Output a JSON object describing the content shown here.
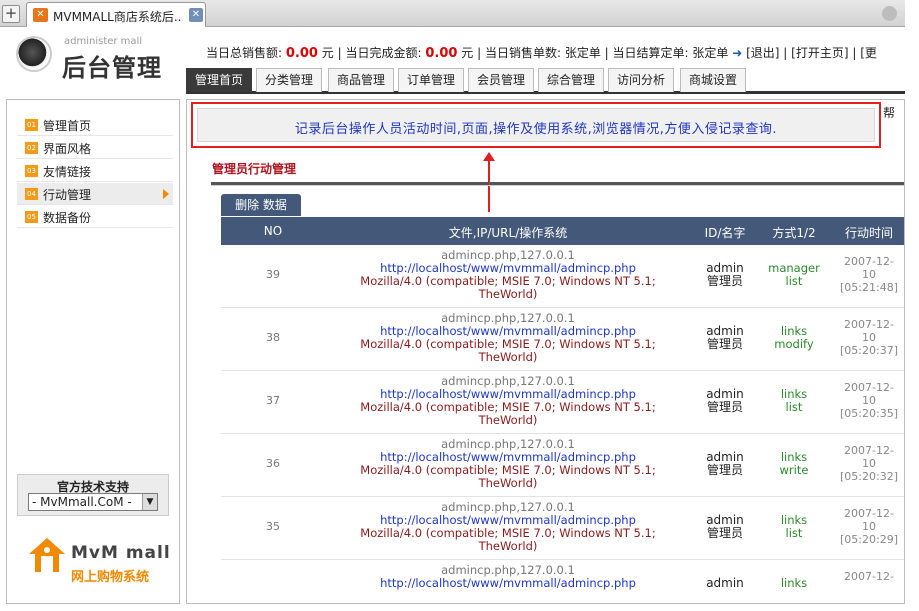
{
  "browser": {
    "new_tab": "+",
    "tab_title": "MVMMALL商店系统后...",
    "tab_icon": "✕",
    "tab_close": "✕"
  },
  "header": {
    "logo_sub": "administer mall",
    "logo_title": "后台管理",
    "info": {
      "sales_label": "当日总销售额:",
      "sales_value": "0.00",
      "unit1": "元",
      "done_label": "| 当日完成金额:",
      "done_value": "0.00",
      "unit2": "元",
      "orders_label": "| 当日销售单数: 张定单",
      "settle_label": "| 当日结算定单: 张定单",
      "arrow": "➜",
      "logout": "[退出]",
      "open_home": "| [打开主页]",
      "more": "| [更"
    },
    "nav": [
      "管理首页",
      "分类管理",
      "商品管理",
      "订单管理",
      "会员管理",
      "综合管理",
      "访问分析",
      "商城设置"
    ]
  },
  "sidebar": {
    "items": [
      {
        "num": "01",
        "label": "管理首页"
      },
      {
        "num": "02",
        "label": "界面风格"
      },
      {
        "num": "03",
        "label": "友情链接"
      },
      {
        "num": "04",
        "label": "行动管理"
      },
      {
        "num": "05",
        "label": "数据备份"
      }
    ],
    "support_title": "官方技术支持",
    "support_select": "- MvMmall.CoM -",
    "support_caret": "▼",
    "brand_name": "MvM mall",
    "brand_tag": "网上购物系统"
  },
  "content": {
    "notice": "记录后台操作人员活动时间,页面,操作及使用系统,浏览器情况,方便入侵记录查询.",
    "notice_extra": "帮",
    "section_title": "管理员行动管理",
    "action_button": "删除 数据",
    "table": {
      "headers": [
        "NO",
        "文件,IP/URL/操作系统",
        "ID/名字",
        "方式1/2",
        "行动时间"
      ],
      "rows": [
        {
          "no": "39",
          "file": "admincp.php,127.0.0.1",
          "url": "http://localhost/www/mvmmall/admincp.php",
          "ua1": "Mozilla/4.0 (compatible; MSIE 7.0; Windows NT 5.1;",
          "ua2": "TheWorld)",
          "id": "admin",
          "name": "管理员",
          "m1": "manager",
          "m2": "list",
          "t1": "2007-12-",
          "t2": "10",
          "t3": "[05:21:48]"
        },
        {
          "no": "38",
          "file": "admincp.php,127.0.0.1",
          "url": "http://localhost/www/mvmmall/admincp.php",
          "ua1": "Mozilla/4.0 (compatible; MSIE 7.0; Windows NT 5.1;",
          "ua2": "TheWorld)",
          "id": "admin",
          "name": "管理员",
          "m1": "links",
          "m2": "modify",
          "t1": "2007-12-",
          "t2": "10",
          "t3": "[05:20:37]"
        },
        {
          "no": "37",
          "file": "admincp.php,127.0.0.1",
          "url": "http://localhost/www/mvmmall/admincp.php",
          "ua1": "Mozilla/4.0 (compatible; MSIE 7.0; Windows NT 5.1;",
          "ua2": "TheWorld)",
          "id": "admin",
          "name": "管理员",
          "m1": "links",
          "m2": "list",
          "t1": "2007-12-",
          "t2": "10",
          "t3": "[05:20:35]"
        },
        {
          "no": "36",
          "file": "admincp.php,127.0.0.1",
          "url": "http://localhost/www/mvmmall/admincp.php",
          "ua1": "Mozilla/4.0 (compatible; MSIE 7.0; Windows NT 5.1;",
          "ua2": "TheWorld)",
          "id": "admin",
          "name": "管理员",
          "m1": "links",
          "m2": "write",
          "t1": "2007-12-",
          "t2": "10",
          "t3": "[05:20:32]"
        },
        {
          "no": "35",
          "file": "admincp.php,127.0.0.1",
          "url": "http://localhost/www/mvmmall/admincp.php",
          "ua1": "Mozilla/4.0 (compatible; MSIE 7.0; Windows NT 5.1;",
          "ua2": "TheWorld)",
          "id": "admin",
          "name": "管理员",
          "m1": "links",
          "m2": "list",
          "t1": "2007-12-",
          "t2": "10",
          "t3": "[05:20:29]"
        },
        {
          "no": "",
          "file": "admincp.php,127.0.0.1",
          "url": "http://localhost/www/mvmmall/admincp.php",
          "ua1": "",
          "ua2": "",
          "id": "admin",
          "name": "",
          "m1": "links",
          "m2": "",
          "t1": "2007-12-",
          "t2": "",
          "t3": ""
        }
      ]
    }
  },
  "colors": {
    "header_bar": "#44597a",
    "notice_border": "#e02020",
    "notice_text": "#1d35c8",
    "accent_orange": "#f08a00",
    "money_red": "#e00000"
  }
}
